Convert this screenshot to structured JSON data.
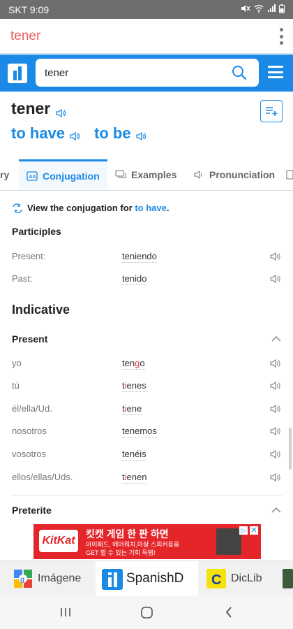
{
  "status": {
    "carrier_time": "SKT 9:09"
  },
  "titlebar": {
    "title": "tener"
  },
  "search": {
    "value": "tener"
  },
  "entry": {
    "headword": "tener",
    "translations": [
      "to have",
      "to be"
    ]
  },
  "tabs": {
    "partial": "ry",
    "conjugation": "Conjugation",
    "examples": "Examples",
    "pronunciation": "Pronunciation"
  },
  "view_conj": {
    "prefix": "View the conjugation for ",
    "link": "to have",
    "suffix": "."
  },
  "participles": {
    "heading": "Participles",
    "rows": [
      {
        "label": "Present:",
        "value": "teniendo"
      },
      {
        "label": "Past:",
        "value": "tenido"
      }
    ]
  },
  "indicative": {
    "heading": "Indicative",
    "present_heading": "Present",
    "rows": [
      {
        "label": "yo",
        "value_pre": "ten",
        "value_red": "g",
        "value_post": "o"
      },
      {
        "label": "tú",
        "value_pre": "t",
        "value_red": "i",
        "value_post": "enes"
      },
      {
        "label": "él/ella/Ud.",
        "value_pre": "t",
        "value_red": "i",
        "value_post": "ene"
      },
      {
        "label": "nosotros",
        "value_pre": "tenemos",
        "value_red": "",
        "value_post": ""
      },
      {
        "label": "vosotros",
        "value_pre": "tenéis",
        "value_red": "",
        "value_post": ""
      },
      {
        "label": "ellos/ellas/Uds.",
        "value_pre": "t",
        "value_red": "i",
        "value_post": "enen"
      }
    ],
    "preterite_heading": "Preterite"
  },
  "ad": {
    "brand": "KitKat",
    "headline": "킷캣 게임 한 판 하면",
    "line1": "아이패드, 에어워치,마샬 스피커등을",
    "line2": "GET 할 수 있는 기회 득템!"
  },
  "app_strip": {
    "images": "Imágene",
    "spanishd": "SpanishD",
    "diclib": "DicLib"
  },
  "colors": {
    "accent": "#1a8ae6",
    "title": "#e8605a",
    "ad": "#e4262a"
  }
}
